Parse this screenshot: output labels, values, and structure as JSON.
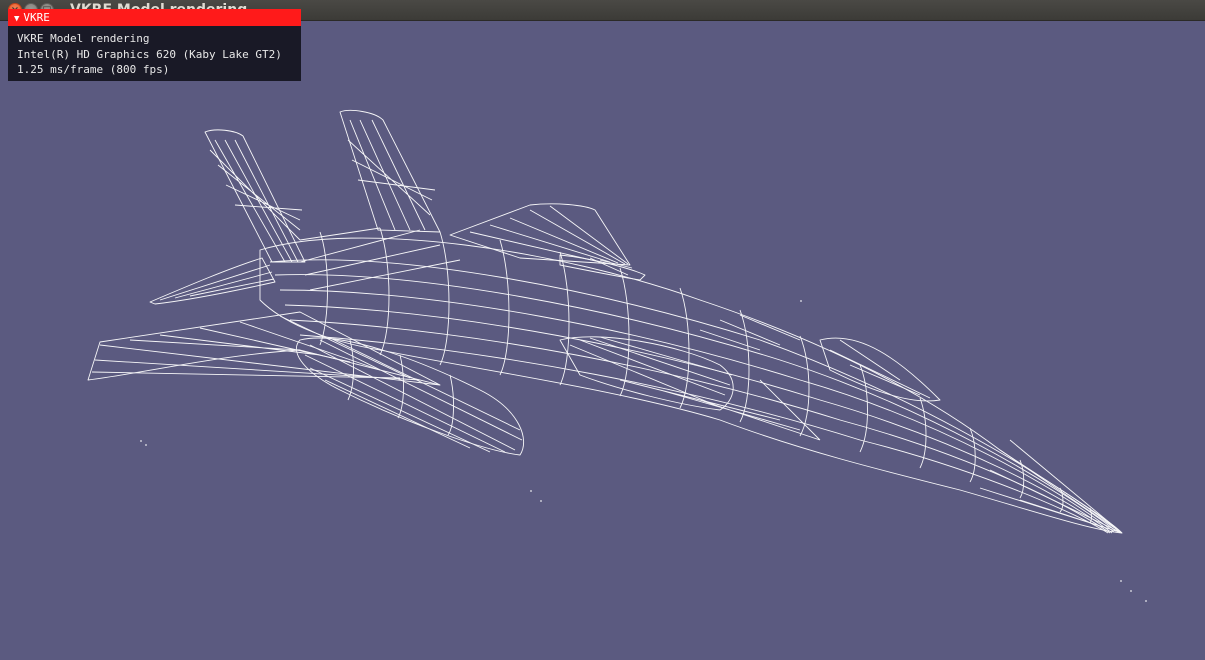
{
  "window": {
    "title": "VKRE Model rendering",
    "close_glyph": "×",
    "min_glyph": "–",
    "max_glyph": "□"
  },
  "overlay": {
    "header_icon": "collapse-triangle-icon",
    "header_label": "VKRE",
    "lines": [
      "VKRE Model rendering",
      "Intel(R) HD Graphics 620 (Kaby Lake GT2)",
      "1.25 ms/frame (800 fps)"
    ]
  },
  "colors": {
    "background": "#5b5a80",
    "wireframe": "#ffffff",
    "overlay_header": "#ff1a1a",
    "overlay_body": "#14141e",
    "titlebar": "#3c3b37"
  }
}
